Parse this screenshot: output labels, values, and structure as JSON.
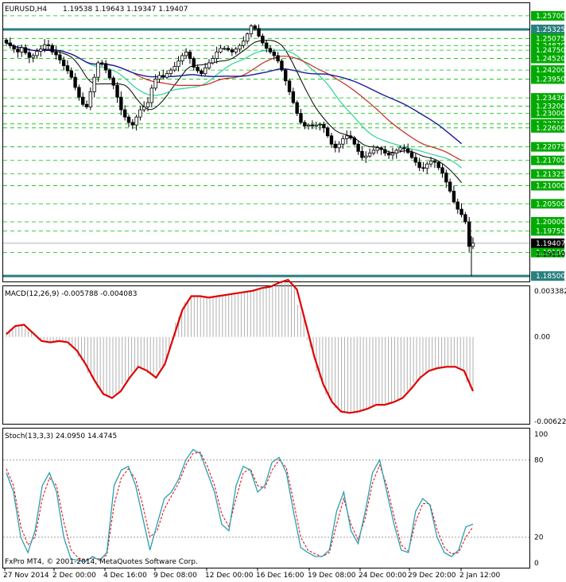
{
  "header": {
    "symbol": "EURUSD,H4",
    "ohlc": "1.19538 1.19643 1.19347 1.19407"
  },
  "colors": {
    "candle": "#000000",
    "guide_green": "#00c000",
    "teal_line": "#2a7f7f",
    "ma_blue": "#1c1c9c",
    "ma_red": "#c8281e",
    "ma_green": "#2ed197",
    "ma_black": "#000000",
    "macd_signal": "#e00000",
    "macd_hist": "#b0b0b0",
    "stoch_main": "#2a9fb0",
    "stoch_signal": "#e00000",
    "price_tag_bg": "#00aa00"
  },
  "chart_data": [
    {
      "type": "candlestick",
      "panel": "price",
      "title": "EURUSD,H4",
      "ylim": [
        1.1835,
        1.2605
      ],
      "price_labels": [
        "1.25700",
        "1.25325",
        "1.25075",
        "1.24870",
        "1.24750",
        "1.24520",
        "1.24200",
        "1.23950",
        "1.23430",
        "1.23200",
        "1.23000",
        "1.22710",
        "1.22600",
        "1.22075",
        "1.21700",
        "1.21325",
        "1.21000",
        "1.20500",
        "1.20000",
        "1.19750",
        "1.19407",
        "1.19150",
        "1.19110",
        "1.18500"
      ],
      "horizontal_levels": [
        1.25325,
        1.185
      ],
      "green_levels": [
        1.257,
        1.25075,
        1.2487,
        1.2475,
        1.2452,
        1.242,
        1.2395,
        1.2343,
        1.232,
        1.23,
        1.2271,
        1.226,
        1.22075,
        1.217,
        1.21325,
        1.21,
        1.205,
        1.2,
        1.1975,
        1.1915
      ],
      "current_price": 1.19407,
      "current_price_label": "1.19407",
      "closes": [
        1.2495,
        1.2487,
        1.2478,
        1.247,
        1.2482,
        1.2468,
        1.2455,
        1.246,
        1.2472,
        1.2478,
        1.249,
        1.2488,
        1.247,
        1.2462,
        1.2448,
        1.2432,
        1.2418,
        1.24,
        1.2372,
        1.2345,
        1.2325,
        1.2318,
        1.236,
        1.24,
        1.244,
        1.2438,
        1.242,
        1.2398,
        1.2378,
        1.2345,
        1.231,
        1.229,
        1.2275,
        1.2268,
        1.229,
        1.231,
        1.2318,
        1.233,
        1.237,
        1.2395,
        1.2405,
        1.24,
        1.241,
        1.242,
        1.243,
        1.2445,
        1.246,
        1.247,
        1.2452,
        1.2428,
        1.2418,
        1.241,
        1.2426,
        1.244,
        1.2452,
        1.247,
        1.248,
        1.248,
        1.2476,
        1.247,
        1.2478,
        1.2488,
        1.25,
        1.252,
        1.2542,
        1.2535,
        1.2514,
        1.2495,
        1.248,
        1.247,
        1.246,
        1.2445,
        1.242,
        1.239,
        1.236,
        1.233,
        1.23,
        1.2275,
        1.2265,
        1.2268,
        1.2265,
        1.2268,
        1.227,
        1.226,
        1.2238,
        1.2215,
        1.2205,
        1.2215,
        1.223,
        1.2238,
        1.2232,
        1.2215,
        1.2195,
        1.2178,
        1.2182,
        1.219,
        1.2198,
        1.2205,
        1.22,
        1.219,
        1.2185,
        1.219,
        1.2198,
        1.2205,
        1.2202,
        1.2192,
        1.2178,
        1.2165,
        1.215,
        1.2148,
        1.216,
        1.2168,
        1.2165,
        1.215,
        1.2135,
        1.211,
        1.2085,
        1.2055,
        1.2035,
        1.202,
        1.2,
        1.1932,
        1.1941
      ]
    },
    {
      "type": "line",
      "panel": "macd",
      "title": "MACD(12,26,9) -0.005788 -0.004083",
      "ylim": [
        -0.006224,
        0.003382
      ],
      "tick_labels": [
        "0.003382",
        "0.00",
        "-0.006224"
      ],
      "signal": [
        0.0002,
        0.0008,
        0.0009,
        0.0003,
        -0.0003,
        -0.0004,
        -0.0003,
        -0.0004,
        -0.001,
        -0.002,
        -0.0032,
        -0.0042,
        -0.0045,
        -0.004,
        -0.003,
        -0.0022,
        -0.0025,
        -0.003,
        -0.002,
        0.0,
        0.002,
        0.003,
        0.003,
        0.0029,
        0.003,
        0.0031,
        0.0032,
        0.0033,
        0.0034,
        0.0036,
        0.0037,
        0.004,
        0.0042,
        0.0035,
        0.001,
        -0.0015,
        -0.0035,
        -0.0048,
        -0.0055,
        -0.0056,
        -0.0055,
        -0.0053,
        -0.005,
        -0.005,
        -0.0048,
        -0.0045,
        -0.0038,
        -0.003,
        -0.0025,
        -0.0023,
        -0.0022,
        -0.0022,
        -0.0025,
        -0.004
      ]
    },
    {
      "type": "line",
      "panel": "stochastic",
      "title": "Stoch(13,3,3) 24.0950 14.4745",
      "ylim": [
        0,
        100
      ],
      "tick_labels": [
        "100",
        "80",
        "20",
        "0"
      ],
      "main": [
        70,
        55,
        20,
        8,
        25,
        60,
        70,
        55,
        20,
        3,
        2,
        1,
        5,
        2,
        8,
        60,
        72,
        75,
        60,
        35,
        10,
        30,
        50,
        55,
        65,
        80,
        88,
        85,
        70,
        55,
        30,
        25,
        60,
        75,
        72,
        55,
        60,
        78,
        82,
        70,
        40,
        12,
        8,
        5,
        5,
        10,
        40,
        55,
        25,
        15,
        40,
        70,
        80,
        55,
        30,
        10,
        8,
        40,
        50,
        45,
        20,
        8,
        5,
        10,
        28,
        30
      ],
      "signal": [
        73,
        60,
        28,
        14,
        20,
        50,
        66,
        60,
        32,
        10,
        4,
        2,
        4,
        3,
        6,
        45,
        66,
        73,
        65,
        45,
        20,
        25,
        42,
        52,
        62,
        76,
        85,
        86,
        75,
        60,
        38,
        28,
        50,
        70,
        73,
        60,
        58,
        72,
        80,
        74,
        48,
        20,
        10,
        7,
        5,
        8,
        30,
        50,
        30,
        18,
        35,
        62,
        76,
        60,
        36,
        14,
        9,
        32,
        46,
        46,
        26,
        12,
        7,
        8,
        20,
        28
      ]
    }
  ],
  "time_axis": [
    "27 Nov 2014",
    "2 Dec 00:00",
    "4 Dec 16:00",
    "9 Dec 08:00",
    "12 Dec 00:00",
    "16 Dec 16:00",
    "19 Dec 08:00",
    "24 Dec 00:00",
    "29 Dec 20:00",
    "2 Jan 12:00"
  ],
  "footer": "FxPro MT4, © 2001-2014, MetaQuotes Software Corp."
}
